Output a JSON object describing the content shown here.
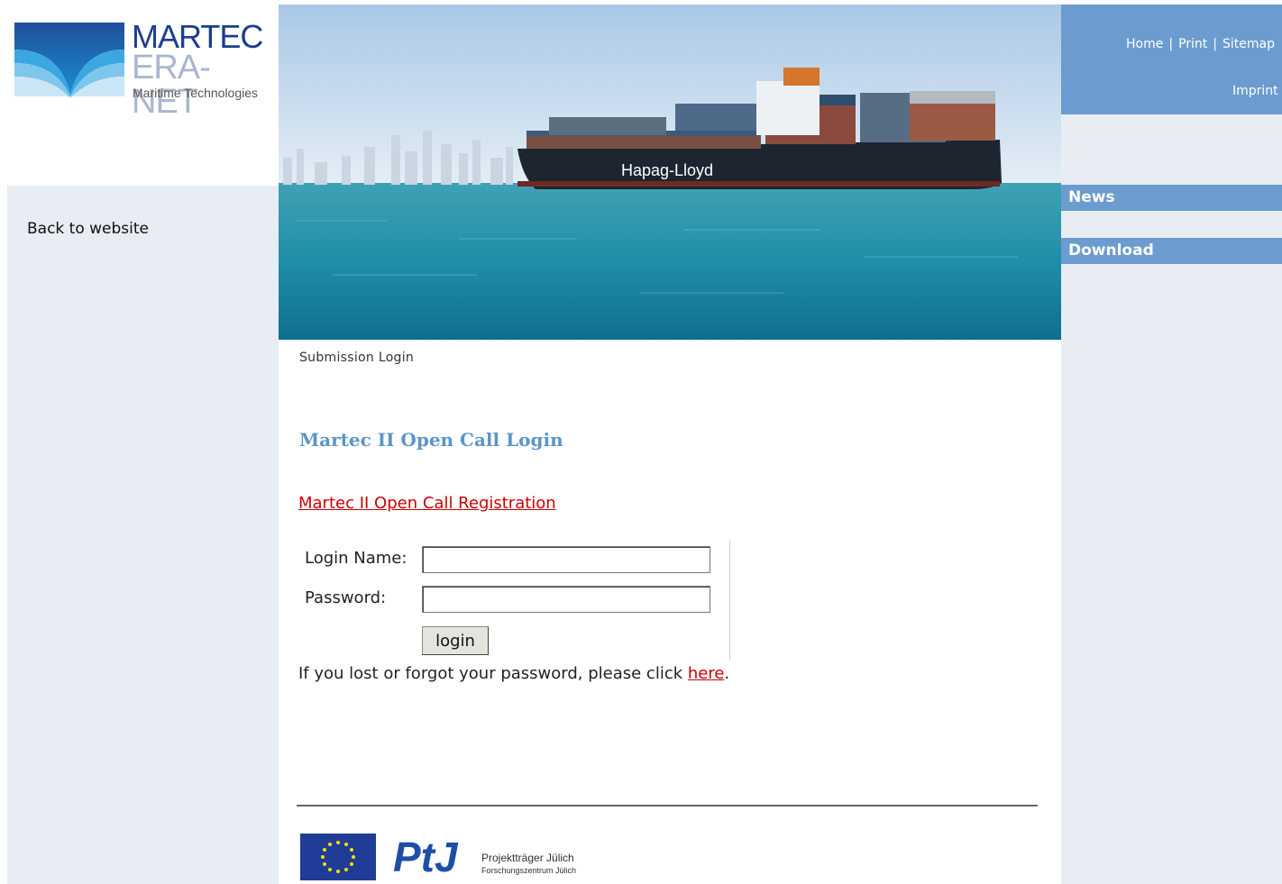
{
  "logo": {
    "line1": "MARTEC",
    "line2": "ERA-NET",
    "line3": "Maritime Technologies"
  },
  "left_nav": {
    "back_label": "Back to website"
  },
  "top_nav": {
    "home": "Home",
    "print": "Print",
    "sitemap": "Sitemap",
    "imprint": "Imprint",
    "separator": "|"
  },
  "side_menu": [
    {
      "label": "News"
    },
    {
      "label": "Download"
    }
  ],
  "hero": {
    "ship_text": "Hapag-Lloyd"
  },
  "main": {
    "breadcrumb": "Submission Login",
    "title": "Martec II Open Call Login",
    "registration_link": "Martec II Open Call Registration",
    "login_name_label": "Login Name:",
    "password_label": "Password:",
    "login_button": "login",
    "forgot_text": "If you lost or forgot your password, please click ",
    "forgot_link": "here",
    "forgot_end": "."
  },
  "footer": {
    "ptj_line1": "Projektträger Jülich",
    "ptj_line2": "Forschungszentrum Jülich",
    "ptj_logo": "PtJ"
  },
  "colors": {
    "accent": "#6c9ccf",
    "sidebar_bg": "#e7edf3",
    "link_red": "#cc0000",
    "title_blue": "#5b95c9"
  }
}
